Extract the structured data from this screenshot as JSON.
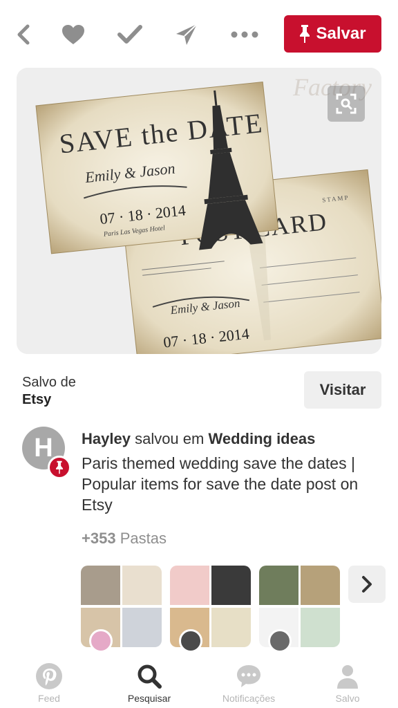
{
  "toolbar": {
    "back_icon": "back-chevron-icon",
    "like_icon": "heart-icon",
    "done_icon": "checkmark-icon",
    "send_icon": "send-icon",
    "more_icon": "more-dots-icon",
    "save_label": "Salvar",
    "save_color": "#c8102e"
  },
  "pin": {
    "source_prefix": "Salvo de",
    "source_name": "Etsy",
    "visit_label": "Visitar",
    "image": {
      "card_front_title": "SAVE the DATE",
      "card_front_names": "Emily & Jason",
      "card_front_date": "07 · 18 · 2014",
      "card_front_venue": "Paris Las Vegas Hotel",
      "card_back_title": "POST CARD",
      "card_back_stamp": "STAMP",
      "card_back_names": "Emily & Jason",
      "card_back_date": "07 · 18 · 2014"
    }
  },
  "saver": {
    "initial": "H",
    "name": "Hayley",
    "action": "salvou em",
    "board": "Wedding ideas",
    "description": "Paris themed wedding save the dates | Popular items for save the date post on Etsy"
  },
  "boards": {
    "count": "+353",
    "label": "Pastas"
  },
  "tabs": [
    {
      "label": "Feed",
      "icon": "pinterest-logo-icon"
    },
    {
      "label": "Pesquisar",
      "icon": "search-icon"
    },
    {
      "label": "Notificações",
      "icon": "speech-bubble-icon"
    },
    {
      "label": "Salvo",
      "icon": "profile-icon"
    }
  ],
  "active_tab": "Pesquisar"
}
